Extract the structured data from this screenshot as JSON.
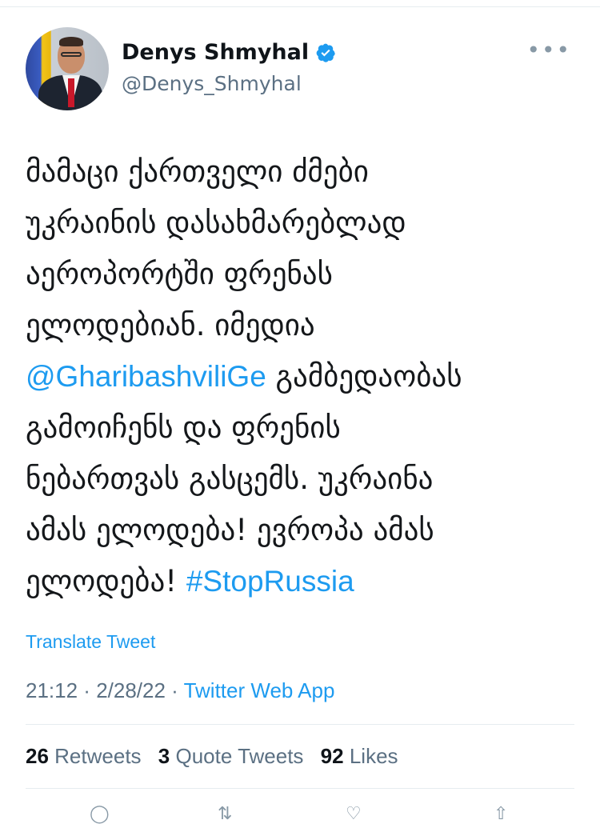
{
  "author": {
    "display_name": "Denys Shmyhal",
    "handle": "@Denys_Shmyhal",
    "verified_icon": "verified-badge-icon"
  },
  "more_label": "•••",
  "tweet": {
    "lines": [
      {
        "text": "მამაცი ქართველი ძმები"
      },
      {
        "text": "უკრაინის დასახმარებლად"
      },
      {
        "text": "აეროპორტში ფრენას"
      },
      {
        "text": "ელოდებიან. იმედია"
      },
      {
        "mention": "@GharibashviliGe",
        "text": " გამბედაობას"
      },
      {
        "text": "გამოიჩენს და ფრენის"
      },
      {
        "text": "ნებართვას გასცემს. უკრაინა"
      },
      {
        "text": "ამას ელოდება! ევროპა ამას"
      },
      {
        "text": "ელოდება! ",
        "hashtag": "#StopRussia"
      }
    ]
  },
  "translate_label": "Translate Tweet",
  "meta": {
    "time": "21:12",
    "sep1": " · ",
    "date": "2/28/22",
    "sep2": " · ",
    "source": "Twitter Web App"
  },
  "stats": {
    "retweets_count": "26",
    "retweets_label": "Retweets",
    "quotes_count": "3",
    "quotes_label": "Quote Tweets",
    "likes_count": "92",
    "likes_label": "Likes"
  },
  "colors": {
    "link": "#1d9bf0",
    "secondary": "#5b7083",
    "text": "#14171a"
  }
}
